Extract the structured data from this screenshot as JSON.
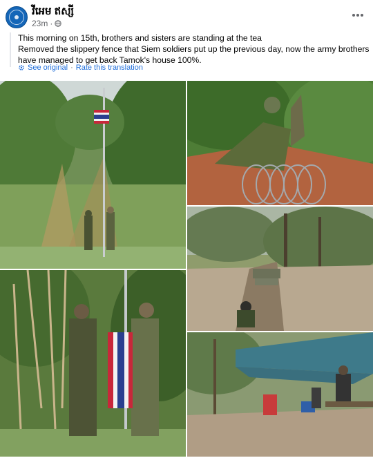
{
  "post": {
    "author": "វីអេម ឥស្សី",
    "time": "23m",
    "dot": "·",
    "privacy_icon": "globe-icon",
    "more_icon": "more-horizontal-icon",
    "text_lines": [
      "This morning on 15th, brothers and sisters are standing at the tea",
      "Removed the slippery fence that Siem soldiers put up the previous day, now the army brothers",
      "have managed to get back Tamok's house 100%."
    ],
    "translation": {
      "icon": "gear-icon",
      "see_original": "See original",
      "separator": "·",
      "rate": "Rate this translation"
    }
  },
  "photos": [
    {
      "subject": "soldiers raising thai flag on pole"
    },
    {
      "subject": "soldier rolling up razor wire"
    },
    {
      "subject": "trench in forest clearing"
    },
    {
      "subject": "soldiers folding thai flag"
    },
    {
      "subject": "camp under blue tarp"
    }
  ],
  "colors": {
    "link": "#216fdb",
    "muted": "#65676b",
    "avatar": "#1466b8"
  }
}
